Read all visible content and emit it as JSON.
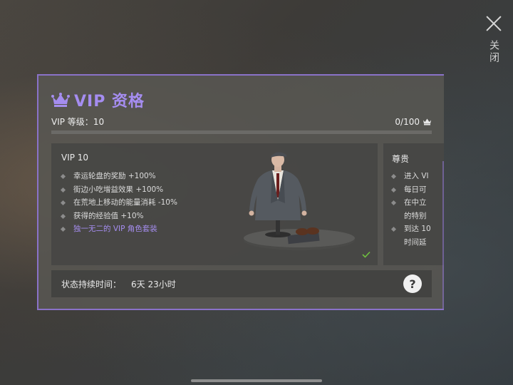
{
  "close": {
    "label": "关闭"
  },
  "panel": {
    "title": "VIP 资格",
    "level_label": "VIP 等级：",
    "level_value": "10",
    "progress_text": "0/100",
    "progress_value": 0.0,
    "accent_color": "#a58df0",
    "vip_card": {
      "title": "VIP 10",
      "benefits": [
        "幸运轮盘的奖励 +100%",
        "街边小吃增益效果 +100%",
        "在荒地上移动的能量消耗 -10%",
        "获得的经验值 +10%",
        "独一无二的 VIP 角色套装"
      ],
      "claimed_icon": "check-icon"
    },
    "noble_card": {
      "title": "尊贵",
      "items": [
        "进入 VI",
        "每日可",
        "在中立",
        "的特别",
        "到达 10",
        "时间延"
      ]
    },
    "duration": {
      "label": "状态持续时间：",
      "value": "6天 23小时",
      "help_label": "?"
    }
  }
}
